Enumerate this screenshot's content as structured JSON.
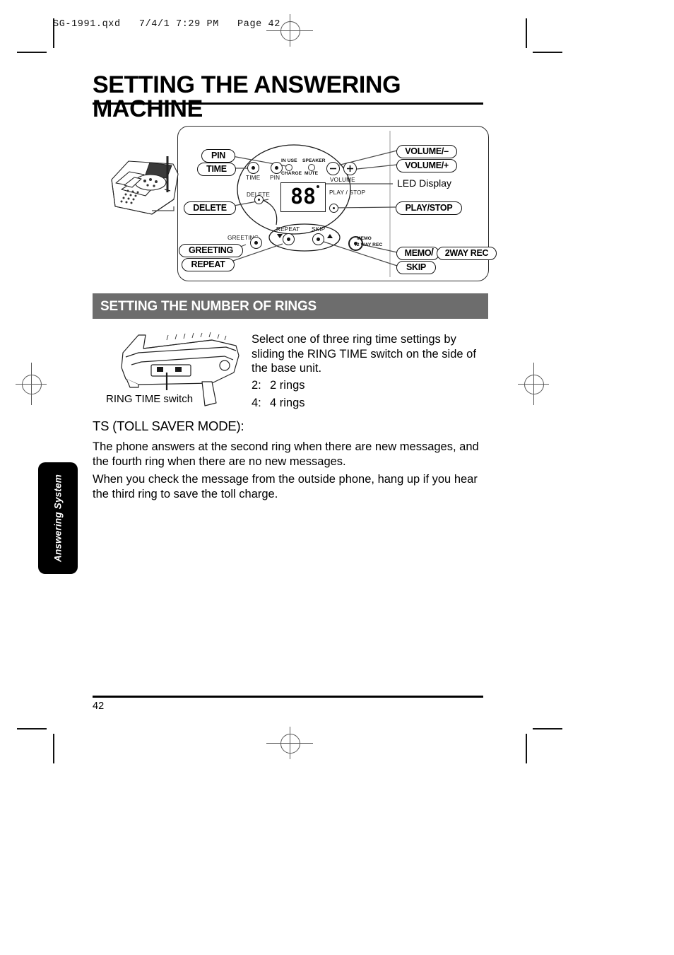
{
  "proof_header": "SG-1991.qxd   7/4/1 7:29 PM   Page 42",
  "chapter_title": "SETTING THE ANSWERING MACHINE",
  "section_band_title": "SETTING THE NUMBER OF RINGS",
  "diagram": {
    "callouts_left": [
      {
        "label": "PIN"
      },
      {
        "label": "TIME"
      },
      {
        "label": "DELETE"
      },
      {
        "label": "GREETING"
      },
      {
        "label": "REPEAT"
      }
    ],
    "callouts_right": [
      {
        "label": "VOLUME/–"
      },
      {
        "label": "VOLUME/+"
      },
      {
        "label": "LED Display"
      },
      {
        "label": "PLAY/STOP"
      },
      {
        "label": "MEMO"
      },
      {
        "label": "2WAY REC"
      },
      {
        "label": "SKIP"
      }
    ],
    "separator": "/",
    "panel_labels": {
      "time": "TIME",
      "pin": "PIN",
      "in_use": "IN USE",
      "charge": "CHARGE",
      "speaker": "SPEAKER",
      "mute": "MUTE",
      "volume": "VOLUME",
      "volume_minus": "–",
      "volume_plus": "+",
      "delete": "DELETE",
      "play_stop": "PLAY / STOP",
      "repeat": "REPEAT",
      "skip": "SKIP",
      "greeting": "GREETING",
      "memo": "MEMO",
      "two_way_rec": "/2 WAY REC"
    },
    "led_display_value": "88"
  },
  "ring_section": {
    "switch_caption": "RING TIME switch",
    "intro": "Select one of three ring time settings by sliding the RING TIME switch on the side of the base unit.",
    "options": [
      {
        "key": "2:",
        "text": "2 rings"
      },
      {
        "key": "4:",
        "text": "4 rings"
      }
    ]
  },
  "toll_saver": {
    "heading": "TS (TOLL SAVER MODE):",
    "paragraph1": "The phone answers at the second ring when there are new messages, and the fourth ring when there are no new messages.",
    "paragraph2": "When you check the message from the outside phone, hang up if you hear the third ring to save the toll charge."
  },
  "side_tab": {
    "label": "Answering System"
  },
  "footer": {
    "page_number": "42"
  }
}
